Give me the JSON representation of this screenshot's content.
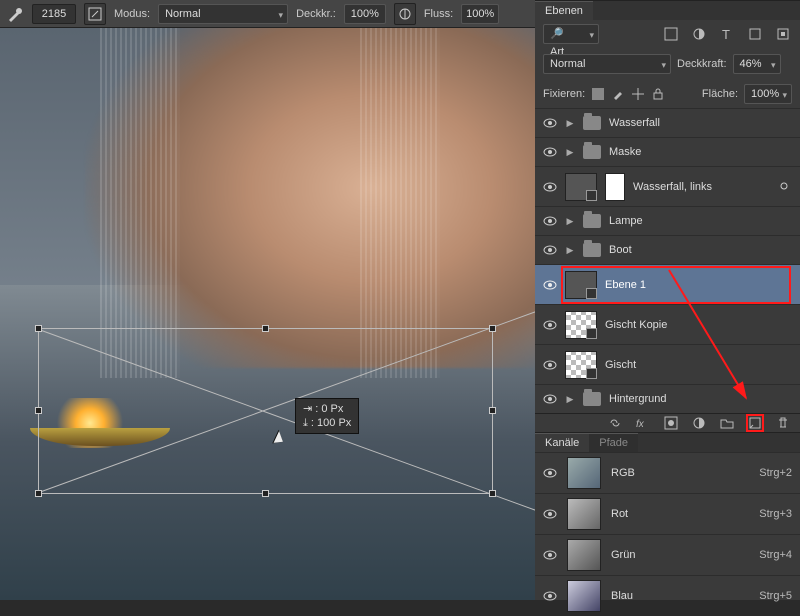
{
  "options": {
    "brush_size": "2185",
    "mode_label": "Modus:",
    "mode_value": "Normal",
    "opacity_label": "Deckkr.:",
    "opacity_value": "100%",
    "flow_label": "Fluss:",
    "flow_value": "100%"
  },
  "transform_tooltip": {
    "line1": "⇥ :   0 Px",
    "line2": "⤓ :   100 Px"
  },
  "panels": {
    "layers_tab": "Ebenen",
    "kind_label": "Art",
    "blend_mode": "Normal",
    "opacity_label": "Deckkraft:",
    "opacity_value": "46%",
    "lock_label": "Fixieren:",
    "fill_label": "Fläche:",
    "fill_value": "100%",
    "channels_tab": "Kanäle",
    "paths_tab": "Pfade"
  },
  "layers": [
    {
      "name": "Wasserfall"
    },
    {
      "name": "Maske"
    },
    {
      "name": "Wasserfall, links"
    },
    {
      "name": "Lampe"
    },
    {
      "name": "Boot"
    },
    {
      "name": "Ebene 1"
    },
    {
      "name": "Gischt Kopie"
    },
    {
      "name": "Gischt"
    },
    {
      "name": "Hintergrund"
    }
  ],
  "channels": [
    {
      "name": "RGB",
      "shortcut": "Strg+2"
    },
    {
      "name": "Rot",
      "shortcut": "Strg+3"
    },
    {
      "name": "Grün",
      "shortcut": "Strg+4"
    },
    {
      "name": "Blau",
      "shortcut": "Strg+5"
    }
  ]
}
